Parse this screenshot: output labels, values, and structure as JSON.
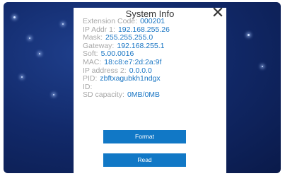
{
  "dialog": {
    "title": "System Info",
    "close_icon": "close-icon",
    "rows": [
      {
        "label": "Extension Code:",
        "value": "000201"
      },
      {
        "label": "IP Addr 1:",
        "value": "192.168.255.26"
      },
      {
        "label": "Mask:",
        "value": "255.255.255.0"
      },
      {
        "label": "Gateway:",
        "value": "192.168.255.1"
      },
      {
        "label": "Soft:",
        "value": "5.00.0016"
      },
      {
        "label": "MAC:",
        "value": "18:c8:e7:2d:2a:9f"
      },
      {
        "label": "IP address 2:",
        "value": "0.0.0.0"
      },
      {
        "label": "PID:",
        "value": "zbftxagubkh1ndgx"
      },
      {
        "label": "ID:",
        "value": ""
      },
      {
        "label": "SD capacity:",
        "value": "0MB/0MB"
      }
    ],
    "buttons": {
      "format_label": "Format",
      "read_label": "Read"
    }
  },
  "colors": {
    "label": "#a7a7a7",
    "value": "#1a76c4",
    "button": "#1178c6",
    "background": "#122a6b"
  }
}
